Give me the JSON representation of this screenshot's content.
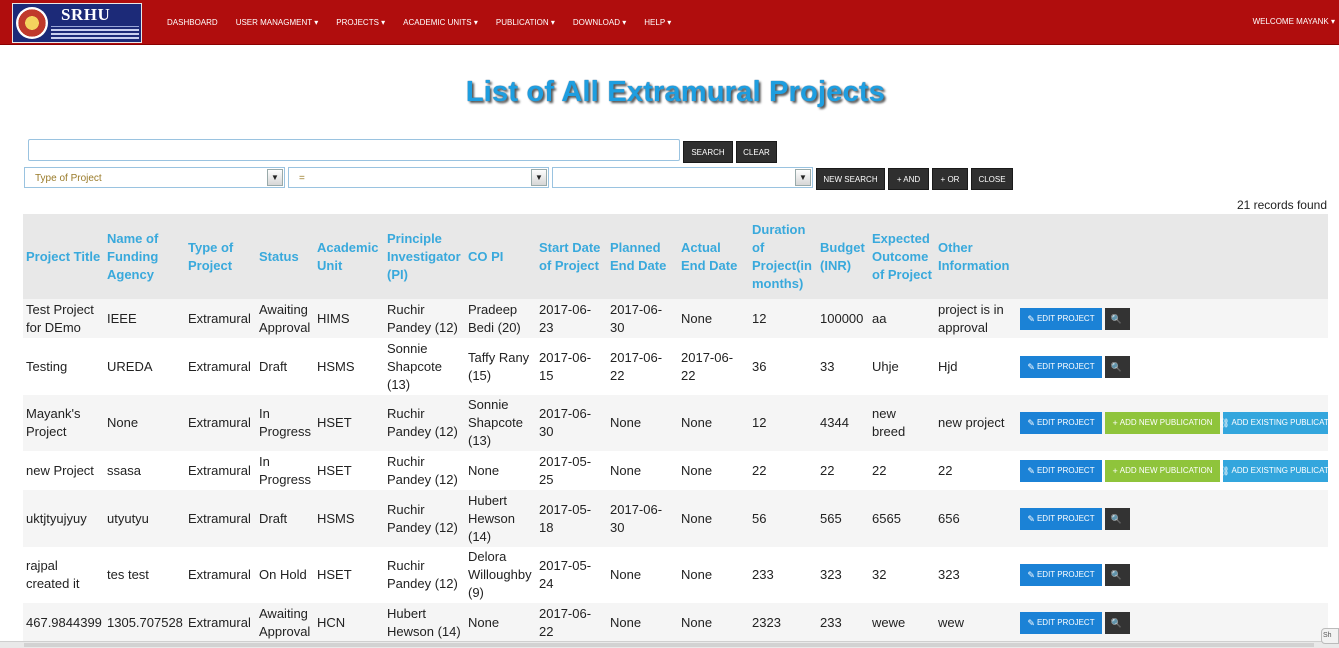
{
  "header": {
    "logo_text": "SRHU",
    "logo_subtitle": "SWAMI RAMA HIMALAYAN UNIVERSITY",
    "nav": [
      "DASHBOARD",
      "USER MANAGMENT",
      "PROJECTS",
      "ACADEMIC UNITS",
      "PUBLICATION",
      "DOWNLOAD",
      "HELP"
    ],
    "welcome": "WELCOME MAYANK"
  },
  "page": {
    "title": "List of All Extramural Projects",
    "records": "21 records found"
  },
  "search": {
    "search_label": "SEARCH",
    "clear_label": "CLEAR",
    "filter_field": "Type of Project",
    "filter_operator": "=",
    "filter_value": "",
    "new_search_label": "NEW SEARCH",
    "and_label": "+ AND",
    "or_label": "+ OR",
    "close_label": "CLOSE"
  },
  "table": {
    "headers": [
      "Project Title",
      "Name of Funding Agency",
      "Type of Project",
      "Status",
      "Academic Unit",
      "Principle Investigator (PI)",
      "CO PI",
      "Start Date of Project",
      "Planned End Date",
      "Actual End Date",
      "Duration of Project(in months)",
      "Budget (INR)",
      "Expected Outcome of Project",
      "Other Information"
    ],
    "actions": {
      "edit": "EDIT PROJECT",
      "add_new_pub": "ADD NEW PUBLICATION",
      "add_existing_pub": "ADD EXISTING PUBLICATION"
    },
    "rows": [
      {
        "cells": [
          "Test Project for DEmo",
          "IEEE",
          "Extramural",
          "Awaiting Approval",
          "HIMS",
          "Ruchir Pandey (12)",
          "Pradeep Bedi (20)",
          "2017-06-23",
          "2017-06-30",
          "None",
          "12",
          "100000",
          "aa",
          "project is in approval"
        ],
        "pub": false
      },
      {
        "cells": [
          "Testing",
          "UREDA",
          "Extramural",
          "Draft",
          "HSMS",
          "Sonnie Shapcote (13)",
          "Taffy Rany (15)",
          "2017-06-15",
          "2017-06-22",
          "2017-06-22",
          "36",
          "33",
          "Uhje",
          "Hjd"
        ],
        "pub": false
      },
      {
        "cells": [
          "Mayank's Project",
          "None",
          "Extramural",
          "In Progress",
          "HSET",
          "Ruchir Pandey (12)",
          "Sonnie Shapcote (13)",
          "2017-06-30",
          "None",
          "None",
          "12",
          "4344",
          "new breed",
          "new project"
        ],
        "pub": true
      },
      {
        "cells": [
          "new Project",
          "ssasa",
          "Extramural",
          "In Progress",
          "HSET",
          "Ruchir Pandey (12)",
          "None",
          "2017-05-25",
          "None",
          "None",
          "22",
          "22",
          "22",
          "22"
        ],
        "pub": true
      },
      {
        "cells": [
          "uktjtyujyuy",
          "utyutyu",
          "Extramural",
          "Draft",
          "HSMS",
          "Ruchir Pandey (12)",
          "Hubert Hewson (14)",
          "2017-05-18",
          "2017-06-30",
          "None",
          "56",
          "565",
          "6565",
          "656"
        ],
        "pub": false
      },
      {
        "cells": [
          "rajpal created it",
          "tes test",
          "Extramural",
          "On Hold",
          "HSET",
          "Ruchir Pandey (12)",
          "Delora Willoughby (9)",
          "2017-05-24",
          "None",
          "None",
          "233",
          "323",
          "32",
          "323"
        ],
        "pub": false
      },
      {
        "cells": [
          "467.9844399",
          "1305.707528",
          "Extramural",
          "Awaiting Approval",
          "HCN",
          "Hubert Hewson (14)",
          "None",
          "2017-06-22",
          "None",
          "None",
          "2323",
          "233",
          "wewe",
          "wew"
        ],
        "pub": false
      }
    ]
  }
}
